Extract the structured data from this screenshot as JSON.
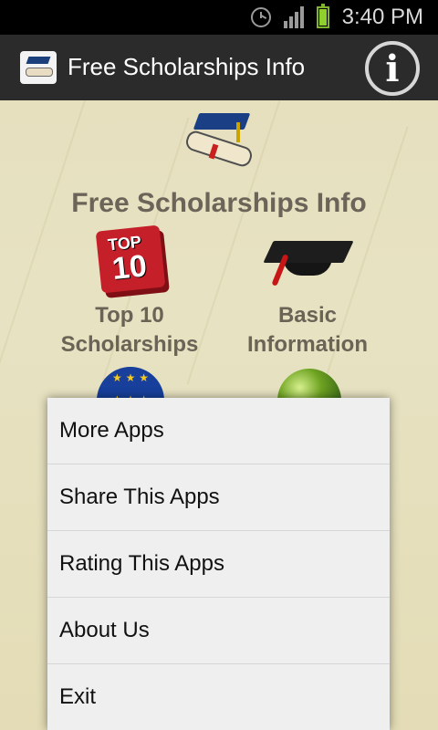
{
  "status_bar": {
    "time": "3:40 PM",
    "icons": [
      "alarm-icon",
      "signal-icon",
      "battery-icon"
    ]
  },
  "action_bar": {
    "title": "Free Scholarships Info",
    "info_icon": "i"
  },
  "content": {
    "title": "Free Scholarships Info",
    "top10_icon_text": {
      "line1": "TOP",
      "line2": "10"
    },
    "tiles": [
      {
        "label_line1": "Top 10",
        "label_line2": "Scholarships",
        "icon": "top10-book-icon"
      },
      {
        "label_line1": "Basic",
        "label_line2": "Information",
        "icon": "graduation-cap-icon"
      }
    ]
  },
  "menu": {
    "items": [
      "More Apps",
      "Share This Apps",
      "Rating This Apps",
      "About Us",
      "Exit"
    ]
  },
  "colors": {
    "status_bar_bg": "#000000",
    "action_bar_bg": "#2b2b2b",
    "menu_bg": "#efefef",
    "label_text": "#6a6356"
  }
}
